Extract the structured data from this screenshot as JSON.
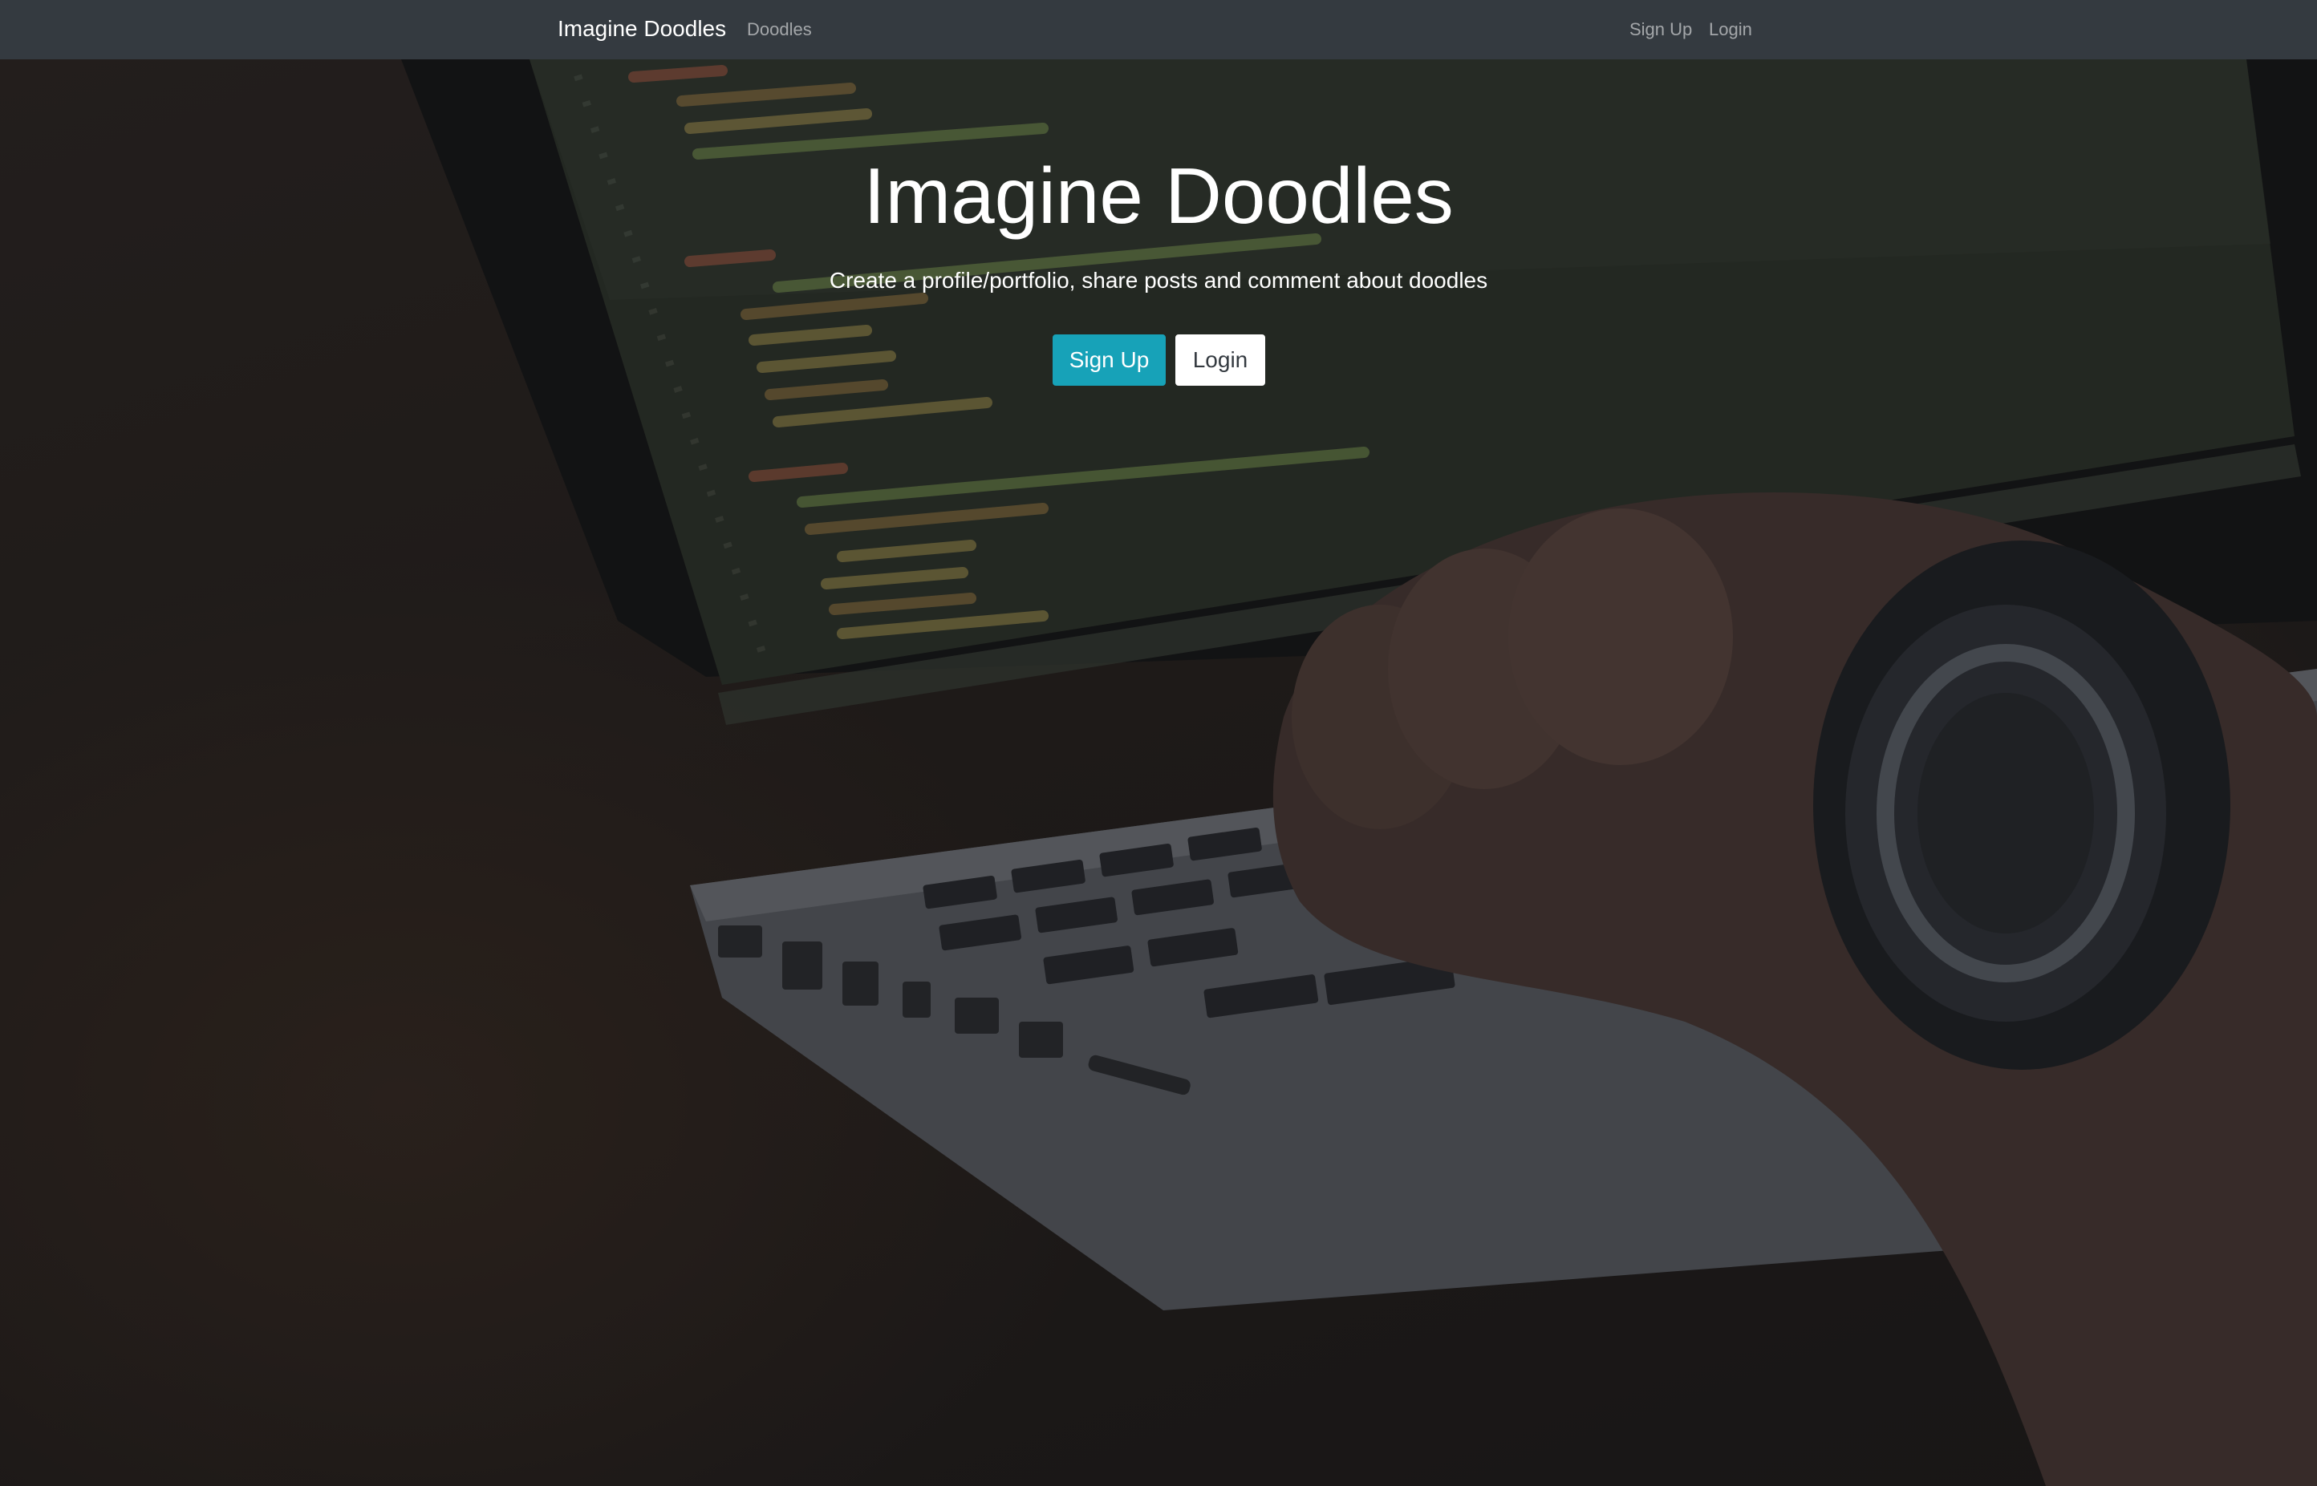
{
  "navbar": {
    "brand": "Imagine Doodles",
    "links": {
      "doodles": "Doodles",
      "signup": "Sign Up",
      "login": "Login"
    }
  },
  "hero": {
    "title": "Imagine Doodles",
    "subtitle": "Create a profile/portfolio, share posts and comment about doodles",
    "buttons": {
      "signup": "Sign Up",
      "login": "Login"
    },
    "background_image": "laptop-with-code-and-hand-typing"
  },
  "colors": {
    "navbar_bg": "#343a40",
    "signup_button": "#17a2b8",
    "login_button": "#ffffff"
  }
}
